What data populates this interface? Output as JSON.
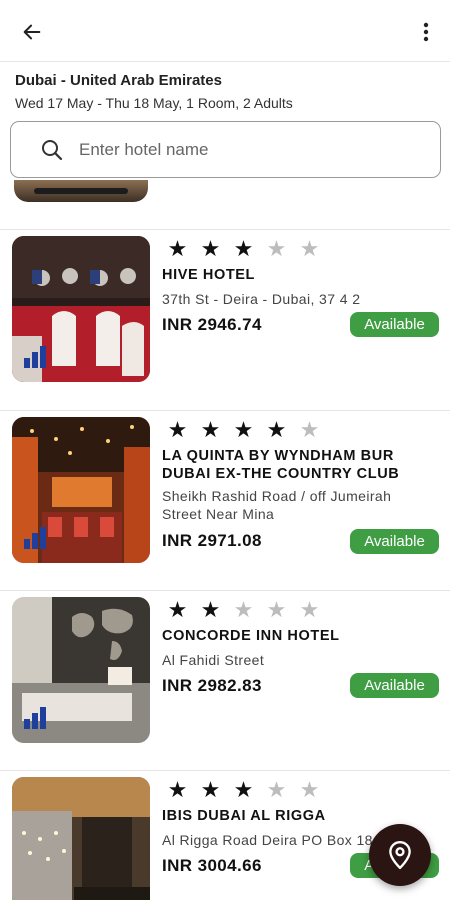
{
  "header": {
    "back_icon": "arrow-left-icon",
    "more_icon": "more-vertical-icon"
  },
  "search_summary": {
    "location": "Dubai - United Arab Emirates",
    "details": "Wed 17 May - Thu 18 May, 1 Room, 2 Adults"
  },
  "search": {
    "placeholder": "Enter hotel name",
    "value": "",
    "icon": "search-icon"
  },
  "hotels": [
    {
      "name": "HIVE HOTEL",
      "address": "37th St - Deira - Dubai, 37 4 2",
      "price": "INR 2946.74",
      "status": "Available",
      "stars": 3,
      "max_stars": 5
    },
    {
      "name": "LA QUINTA BY WYNDHAM BUR DUBAI EX-THE COUNTRY CLUB",
      "address": "Sheikh Rashid Road / off Jumeirah Street Near Mina",
      "price": "INR 2971.08",
      "status": "Available",
      "stars": 4,
      "max_stars": 5
    },
    {
      "name": "CONCORDE INN HOTEL",
      "address": "Al Fahidi Street",
      "price": "INR 2982.83",
      "status": "Available",
      "stars": 2,
      "max_stars": 5
    },
    {
      "name": "IBIS DUBAI AL RIGGA",
      "address": "Al Rigga Road Deira PO Box 18",
      "price": "INR 3004.66",
      "status": "Available",
      "stars": 3,
      "max_stars": 5
    }
  ],
  "map_fab": {
    "icon": "map-pin-icon"
  },
  "colors": {
    "available_badge": "#3f9e43",
    "fab_background": "#2a1512",
    "star_filled": "#111111",
    "star_empty": "#bdbdbd"
  }
}
